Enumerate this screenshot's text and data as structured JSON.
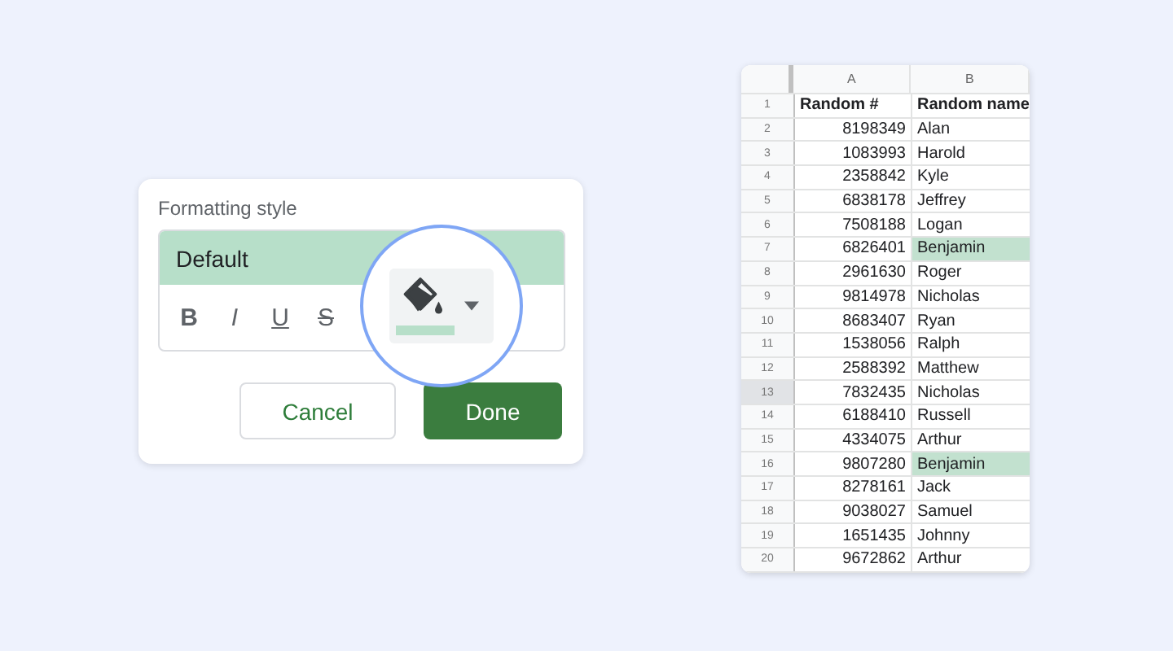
{
  "dialog": {
    "title": "Formatting style",
    "style_preview": "Default",
    "toolbar": [
      {
        "label": "B",
        "kind": "bold"
      },
      {
        "label": "I",
        "kind": "italic"
      },
      {
        "label": "U",
        "kind": "underline"
      },
      {
        "label": "S",
        "kind": "strike"
      }
    ],
    "buttons": [
      {
        "label": "Cancel",
        "kind": "secondary"
      },
      {
        "label": "Done",
        "kind": "primary"
      }
    ]
  },
  "sheet": {
    "columns": [
      "A",
      "B"
    ],
    "rows": [
      {
        "num": "1",
        "a": "Random #",
        "b": "Random name",
        "header": true,
        "selected": false,
        "highlighted": false
      },
      {
        "num": "2",
        "a": "8198349",
        "b": "Alan",
        "header": false,
        "selected": false,
        "highlighted": false
      },
      {
        "num": "3",
        "a": "1083993",
        "b": "Harold",
        "header": false,
        "selected": false,
        "highlighted": false
      },
      {
        "num": "4",
        "a": "2358842",
        "b": "Kyle",
        "header": false,
        "selected": false,
        "highlighted": false
      },
      {
        "num": "5",
        "a": "6838178",
        "b": "Jeffrey",
        "header": false,
        "selected": false,
        "highlighted": false
      },
      {
        "num": "6",
        "a": "7508188",
        "b": "Logan",
        "header": false,
        "selected": false,
        "highlighted": false
      },
      {
        "num": "7",
        "a": "6826401",
        "b": "Benjamin",
        "header": false,
        "selected": false,
        "highlighted": true
      },
      {
        "num": "8",
        "a": "2961630",
        "b": "Roger",
        "header": false,
        "selected": false,
        "highlighted": false
      },
      {
        "num": "9",
        "a": "9814978",
        "b": "Nicholas",
        "header": false,
        "selected": false,
        "highlighted": false
      },
      {
        "num": "10",
        "a": "8683407",
        "b": "Ryan",
        "header": false,
        "selected": false,
        "highlighted": false
      },
      {
        "num": "11",
        "a": "1538056",
        "b": "Ralph",
        "header": false,
        "selected": false,
        "highlighted": false
      },
      {
        "num": "12",
        "a": "2588392",
        "b": "Matthew",
        "header": false,
        "selected": false,
        "highlighted": false
      },
      {
        "num": "13",
        "a": "7832435",
        "b": "Nicholas",
        "header": false,
        "selected": true,
        "highlighted": false
      },
      {
        "num": "14",
        "a": "6188410",
        "b": "Russell",
        "header": false,
        "selected": false,
        "highlighted": false
      },
      {
        "num": "15",
        "a": "4334075",
        "b": "Arthur",
        "header": false,
        "selected": false,
        "highlighted": false
      },
      {
        "num": "16",
        "a": "9807280",
        "b": "Benjamin",
        "header": false,
        "selected": false,
        "highlighted": true
      },
      {
        "num": "17",
        "a": "8278161",
        "b": "Jack",
        "header": false,
        "selected": false,
        "highlighted": false
      },
      {
        "num": "18",
        "a": "9038027",
        "b": "Samuel",
        "header": false,
        "selected": false,
        "highlighted": false
      },
      {
        "num": "19",
        "a": "1651435",
        "b": "Johnny",
        "header": false,
        "selected": false,
        "highlighted": false
      },
      {
        "num": "20",
        "a": "9672862",
        "b": "Arthur",
        "header": false,
        "selected": false,
        "highlighted": false
      }
    ]
  }
}
